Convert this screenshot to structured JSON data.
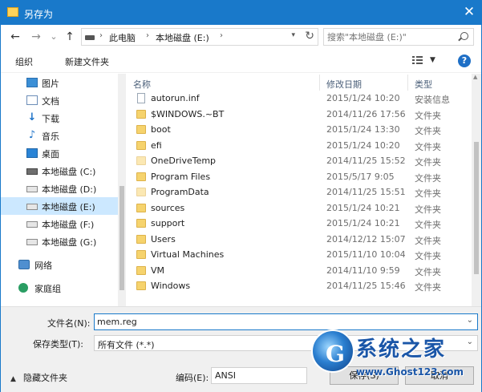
{
  "window": {
    "title": "另存为",
    "close_glyph": "✕"
  },
  "nav": {
    "back_glyph": "←",
    "forward_glyph": "→",
    "recent_glyph": "⌄",
    "up_glyph": "↑",
    "address": {
      "crumbs": [
        "此电脑",
        "本地磁盘 (E:)"
      ],
      "separator": "›"
    },
    "search_placeholder": "搜索\"本地磁盘 (E:)\""
  },
  "commands": {
    "organize": "组织",
    "new_folder": "新建文件夹",
    "help": "?"
  },
  "sidebar": {
    "items": [
      {
        "label": "图片",
        "icon": "pictures-icon"
      },
      {
        "label": "文档",
        "icon": "documents-icon"
      },
      {
        "label": "下载",
        "icon": "downloads-icon"
      },
      {
        "label": "音乐",
        "icon": "music-icon"
      },
      {
        "label": "桌面",
        "icon": "desktop-icon"
      },
      {
        "label": "本地磁盘 (C:)",
        "icon": "drive-icon"
      },
      {
        "label": "本地磁盘 (D:)",
        "icon": "drive-icon"
      },
      {
        "label": "本地磁盘 (E:)",
        "icon": "drive-icon",
        "selected": true
      },
      {
        "label": "本地磁盘 (F:)",
        "icon": "drive-icon"
      },
      {
        "label": "本地磁盘 (G:)",
        "icon": "drive-icon"
      },
      {
        "label": "网络",
        "icon": "network-icon"
      },
      {
        "label": "家庭组",
        "icon": "homegroup-icon"
      }
    ]
  },
  "list": {
    "columns": {
      "name": "名称",
      "modified": "修改日期",
      "type": "类型"
    },
    "files": [
      {
        "name": "autorun.inf",
        "modified": "2015/1/24 10:20",
        "type": "安装信息",
        "kind": "file"
      },
      {
        "name": "$WINDOWS.~BT",
        "modified": "2014/11/26 17:56",
        "type": "文件夹",
        "kind": "folder"
      },
      {
        "name": "boot",
        "modified": "2015/1/24 13:30",
        "type": "文件夹",
        "kind": "folder"
      },
      {
        "name": "efi",
        "modified": "2015/1/24 10:20",
        "type": "文件夹",
        "kind": "folder"
      },
      {
        "name": "OneDriveTemp",
        "modified": "2014/11/25 15:52",
        "type": "文件夹",
        "kind": "folder-hidden"
      },
      {
        "name": "Program Files",
        "modified": "2015/5/17 9:05",
        "type": "文件夹",
        "kind": "folder"
      },
      {
        "name": "ProgramData",
        "modified": "2014/11/25 15:51",
        "type": "文件夹",
        "kind": "folder-hidden"
      },
      {
        "name": "sources",
        "modified": "2015/1/24 10:21",
        "type": "文件夹",
        "kind": "folder"
      },
      {
        "name": "support",
        "modified": "2015/1/24 10:21",
        "type": "文件夹",
        "kind": "folder"
      },
      {
        "name": "Users",
        "modified": "2014/12/12 15:07",
        "type": "文件夹",
        "kind": "folder"
      },
      {
        "name": "Virtual Machines",
        "modified": "2015/11/10 10:04",
        "type": "文件夹",
        "kind": "folder"
      },
      {
        "name": "VM",
        "modified": "2014/11/10 9:59",
        "type": "文件夹",
        "kind": "folder"
      },
      {
        "name": "Windows",
        "modified": "2014/11/25 15:46",
        "type": "文件夹",
        "kind": "folder"
      }
    ]
  },
  "form": {
    "filename_label": "文件名(N):",
    "filename_value": "mem.reg",
    "filetype_label": "保存类型(T):",
    "filetype_value": "所有文件  (*.*)",
    "hide_folders": "隐藏文件夹",
    "encoding_label": "编码(E):",
    "encoding_value": "ANSI",
    "save_button": "保存(S)",
    "cancel_button": "取消"
  },
  "watermark": {
    "title": "系统之家",
    "url": "www.Ghost123.com"
  },
  "colors": {
    "accent": "#1979ca",
    "selection": "#cce8ff",
    "folder": "#f6d36d"
  }
}
